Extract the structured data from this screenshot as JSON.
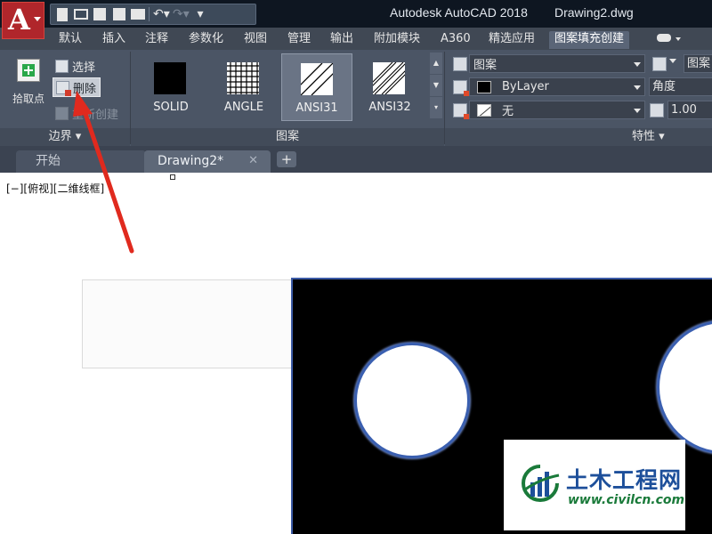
{
  "app": {
    "title": "Autodesk AutoCAD 2018",
    "file_name": "Drawing2.dwg",
    "logo_letter": "A"
  },
  "quick_access": {
    "icons": [
      "new-icon",
      "open-icon",
      "save-icon",
      "save-as-icon",
      "print-icon",
      "undo-icon",
      "redo-icon",
      "customize-icon"
    ]
  },
  "ribbon_tabs": [
    {
      "label": "默认"
    },
    {
      "label": "插入"
    },
    {
      "label": "注释"
    },
    {
      "label": "参数化"
    },
    {
      "label": "视图"
    },
    {
      "label": "管理"
    },
    {
      "label": "输出"
    },
    {
      "label": "附加模块"
    },
    {
      "label": "A360"
    },
    {
      "label": "精选应用"
    },
    {
      "label": "图案填充创建",
      "active": true
    }
  ],
  "boundary_panel": {
    "pick_points_label": "拾取点",
    "select_label": "选择",
    "delete_label": "删除",
    "recreate_label": "重新创建",
    "panel_title": "边界"
  },
  "pattern_panel": {
    "patterns": [
      {
        "label": "SOLID"
      },
      {
        "label": "ANGLE"
      },
      {
        "label": "ANSI31",
        "selected": true
      },
      {
        "label": "ANSI32"
      }
    ],
    "panel_title": "图案"
  },
  "properties_panel": {
    "hatch_type": "图案",
    "hatch_color": "ByLayer",
    "background_color": "无",
    "angle_label": "角度",
    "scale_value": "1.00",
    "pattern_partial": "图案",
    "panel_title": "特性"
  },
  "document_tabs": {
    "start_label": "开始",
    "drawing_label": "Drawing2*",
    "close_glyph": "✕",
    "add_glyph": "+"
  },
  "canvas": {
    "view_label": "[−][俯视][二维线框]"
  },
  "watermark": {
    "name": "土木工程网",
    "url": "www.civilcn.com"
  },
  "colors": {
    "title_bar": "#0e1621",
    "ribbon_bg": "#4b5565",
    "app_button": "#b0262b",
    "hatch_fill": "#000000",
    "boundary_blue": "#3a5fb0",
    "annotation_arrow": "#e02a1e",
    "watermark_blue": "#1d4f9a",
    "watermark_green": "#1a7a3a"
  }
}
